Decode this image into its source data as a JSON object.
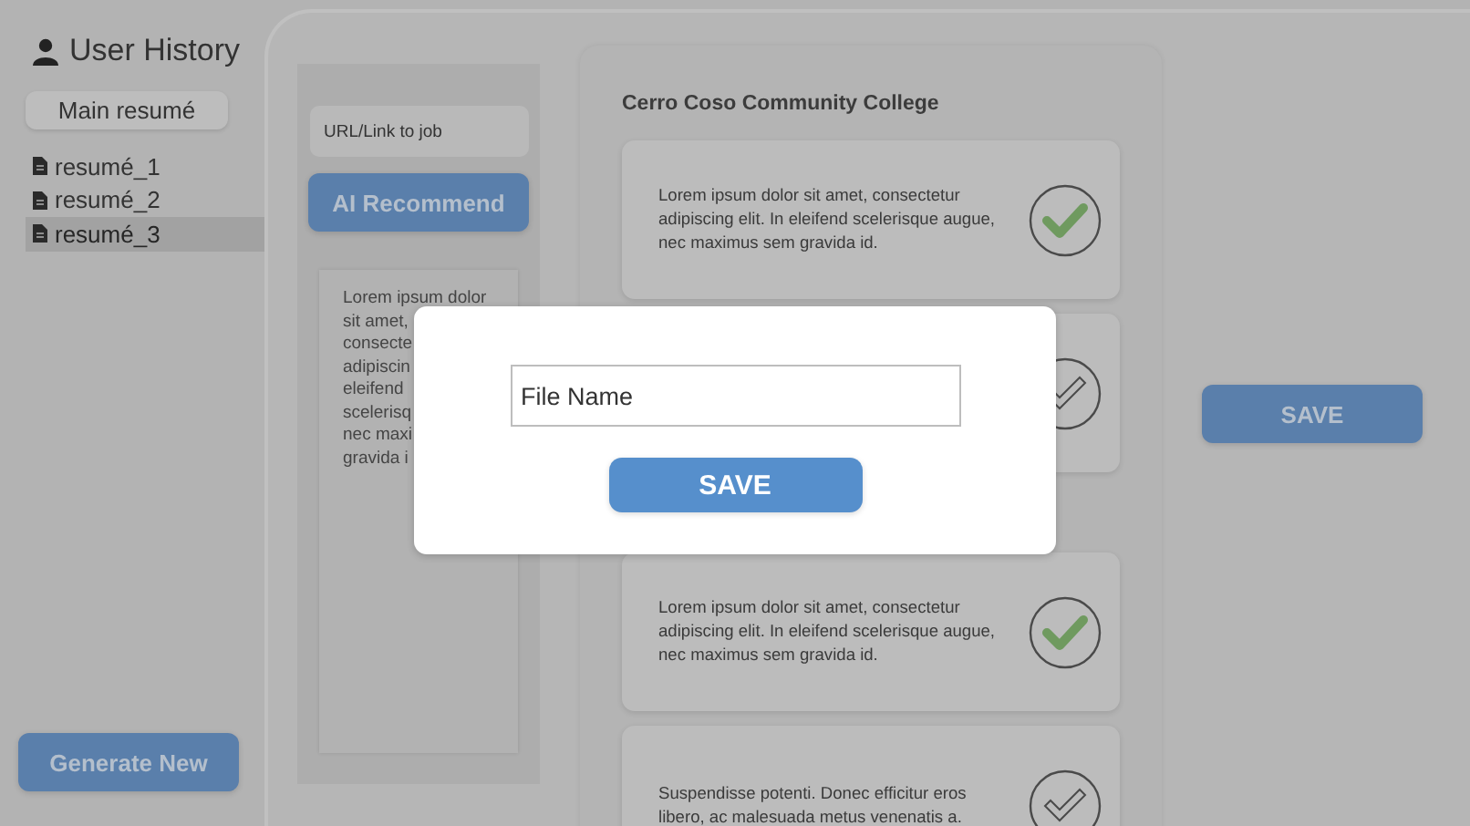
{
  "sidebar": {
    "title": "User History",
    "main_button": "Main resumé",
    "items": [
      {
        "label": "resumé_1",
        "selected": false
      },
      {
        "label": "resumé_2",
        "selected": false
      },
      {
        "label": "resumé_3",
        "selected": true
      }
    ],
    "generate_button": "Generate New"
  },
  "job_panel": {
    "url_placeholder": "URL/Link to job",
    "recommend_button": "AI Recommend",
    "text_lines": [
      "Lorem ipsum dolor",
      "sit amet,",
      "consecte",
      "adipiscin",
      "eleifend",
      "scelerisq",
      "nec maxi",
      "gravida i"
    ]
  },
  "college": {
    "title": "Cerro Coso Community College",
    "entries": [
      {
        "text": "Lorem ipsum dolor sit amet, consectetur adipiscing elit. In eleifend scelerisque augue, nec maximus sem gravida id.",
        "checked": true
      },
      {
        "checked": false
      },
      {
        "text": "Lorem ipsum dolor sit amet, consectetur adipiscing elit. In eleifend scelerisque augue, nec maximus sem gravida id.",
        "checked": true
      },
      {
        "text": "Suspendisse potenti. Donec efficitur eros libero, ac malesuada metus venenatis a.",
        "checked": false
      }
    ]
  },
  "save_button": "SAVE",
  "dialog": {
    "placeholder": "File Name",
    "save_button": "SAVE"
  }
}
